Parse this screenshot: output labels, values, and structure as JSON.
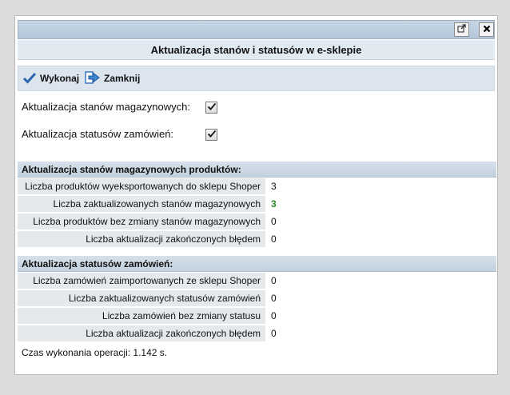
{
  "dialog": {
    "title": "Aktualizacja stanów i statusów w e-sklepie",
    "toolbar": {
      "execute_label": "Wykonaj",
      "close_label": "Zamknij"
    },
    "options": [
      {
        "label": "Aktualizacja stanów magazynowych:",
        "checked": true
      },
      {
        "label": "Aktualizacja statusów zamówień:",
        "checked": true
      }
    ],
    "stock_section": {
      "heading": "Aktualizacja stanów magazynowych produktów:",
      "rows": [
        {
          "label": "Liczba produktów wyeksportowanych do sklepu Shoper",
          "value": "3"
        },
        {
          "label": "Liczba zaktualizowanych stanów magazynowych",
          "value": "3",
          "color": "#2a8a2a"
        },
        {
          "label": "Liczba produktów bez zmiany stanów magazynowych",
          "value": "0"
        },
        {
          "label": "Liczba aktualizacji zakończonych błędem",
          "value": "0"
        }
      ]
    },
    "status_section": {
      "heading": "Aktualizacja statusów zamówień:",
      "rows": [
        {
          "label": "Liczba zamówień zaimportowanych ze sklepu Shoper",
          "value": "0"
        },
        {
          "label": "Liczba zaktualizowanych statusów zamówień",
          "value": "0"
        },
        {
          "label": "Liczba zamówień bez zmiany statusu",
          "value": "0"
        },
        {
          "label": "Liczba aktualizacji zakończonych błędem",
          "value": "0"
        }
      ]
    },
    "footer_text": "Czas wykonania operacji: 1.142 s.",
    "window_buttons": {
      "popout_icon": "external-link-icon",
      "close_icon": "close-icon"
    }
  }
}
